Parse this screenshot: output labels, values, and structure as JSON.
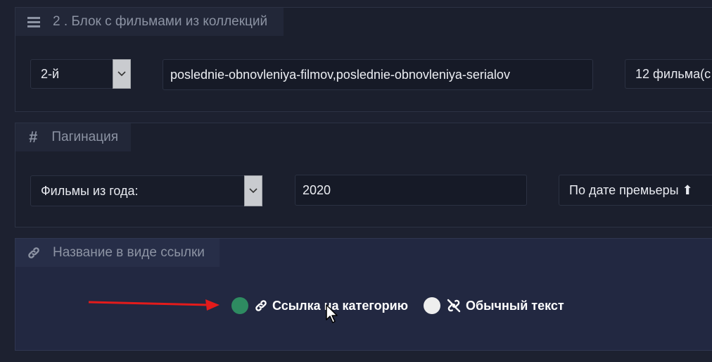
{
  "block": {
    "title": "2 . Блок с фильмами из коллекций",
    "position_select": "2-й",
    "collections_value": "poslednie-obnovleniya-filmov,poslednie-obnovleniya-serialov",
    "count_select": "12 фильма(с"
  },
  "pagination": {
    "title": "Пагинация",
    "source_select": "Фильмы из года:",
    "year_value": "2020",
    "sort_select": "По дате премьеры ⬆"
  },
  "link_title": {
    "title": "Название в виде ссылки",
    "options": [
      {
        "label": "Ссылка на категорию",
        "selected": true,
        "icon": "link-icon"
      },
      {
        "label": "Обычный текст",
        "selected": false,
        "icon": "unlink-icon"
      }
    ]
  },
  "colors": {
    "selected_radio": "#2e8b61",
    "unselected_radio": "#eeeeee",
    "arrow": "#e31b1b"
  }
}
